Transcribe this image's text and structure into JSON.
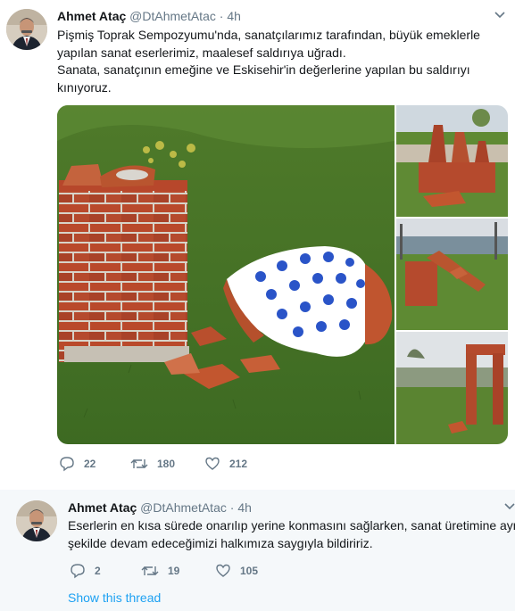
{
  "tweet": {
    "author_name": "Ahmet Ataç",
    "handle": "@DtAhmetAtac",
    "separator": "·",
    "time": "4h",
    "text_lines": [
      "Pişmiş Toprak Sempozyumu'nda, sanatçılarımız tarafından, büyük emeklerle",
      "yapılan sanat eserlerimiz, maalesef saldırıya uğradı.",
      "Sanata, sanatçının emeğine ve Eskisehir'in değerlerine yapılan bu saldırıyı",
      "kınıyoruz."
    ],
    "replies": "22",
    "retweets": "180",
    "likes": "212"
  },
  "reply": {
    "author_name": "Ahmet Ataç",
    "handle": "@DtAhmetAtac",
    "separator": "·",
    "time": "4h",
    "text_lines": [
      "Eserlerin en kısa sürede onarılıp yerine konmasını sağlarken, sanat üretimine aynı",
      "şekilde devam edeceğimizi halkımıza saygıyla bildiririz."
    ],
    "replies": "2",
    "retweets": "19",
    "likes": "105",
    "show_thread": "Show this thread"
  },
  "colors": {
    "text": "#14171a",
    "secondary": "#657786",
    "link": "#1da1f2",
    "reply_bg": "#f5f8fa"
  },
  "icons": [
    "chevron-down-icon",
    "reply-icon",
    "retweet-icon",
    "like-icon"
  ]
}
